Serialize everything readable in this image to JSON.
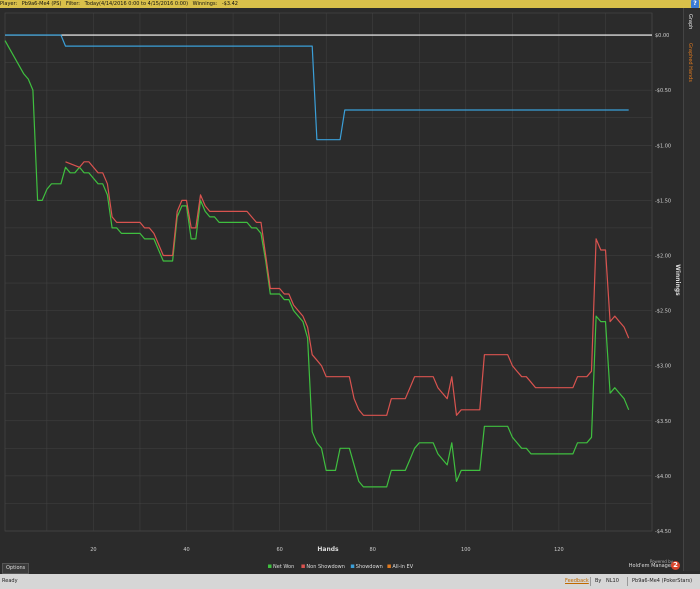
{
  "header": {
    "player_label": "Player:",
    "player_value": "Pb9a6-Me4 (PS)",
    "filter_label": "Filter:",
    "filter_value": "Today(4/14/2016 0:00 to 4/15/2016 0:00)",
    "winnings_label": "Winnings:",
    "winnings_value": "-$3.42",
    "help": "?"
  },
  "sidebar": {
    "tab_graph": "Graph",
    "tab_graphed_hands": "Graphed Hands"
  },
  "footer": {
    "options_label": "Options",
    "powered_by": "Powered by",
    "brand": "Hold'em Manager",
    "brand_badge": "2"
  },
  "statusbar": {
    "ready": "Ready",
    "feedback": "Feedback",
    "by": "By",
    "database": "NL10",
    "player": "Pb9a6-Me4 (PokerStars)"
  },
  "colors": {
    "background": "#2b2b2b",
    "grid": "#444444",
    "net_won": "#3fbf3f",
    "non_showdown": "#d9534f",
    "showdown": "#3b9fd8",
    "all_in_ev": "#e07a1f",
    "zero_line": "#ffffff"
  },
  "chart_data": {
    "type": "line",
    "xlabel": "Hands",
    "ylabel": "Winnings",
    "xlim": [
      1,
      140
    ],
    "ylim": [
      -4.5,
      0.2
    ],
    "x_ticks": [
      20,
      40,
      60,
      80,
      100,
      120
    ],
    "y_ticks": [
      "$0.00",
      "-$0.50",
      "-$1.00",
      "-$1.50",
      "-$2.00",
      "-$2.50",
      "-$3.00",
      "-$3.50",
      "-$4.00",
      "-$4.50"
    ],
    "y_tick_values": [
      0,
      -0.5,
      -1.0,
      -1.5,
      -2.0,
      -2.5,
      -3.0,
      -3.5,
      -4.0,
      -4.5
    ],
    "grid": true,
    "legend_position": "bottom-center",
    "series": [
      {
        "name": "Net Won",
        "color": "#3fbf3f",
        "points": [
          [
            1,
            -0.05
          ],
          [
            3,
            -0.2
          ],
          [
            5,
            -0.35
          ],
          [
            6,
            -0.4
          ],
          [
            7,
            -0.5
          ],
          [
            8,
            -1.5
          ],
          [
            9,
            -1.5
          ],
          [
            10,
            -1.4
          ],
          [
            11,
            -1.35
          ],
          [
            12,
            -1.35
          ],
          [
            13,
            -1.35
          ],
          [
            14,
            -1.2
          ],
          [
            15,
            -1.25
          ],
          [
            16,
            -1.25
          ],
          [
            17,
            -1.2
          ],
          [
            18,
            -1.25
          ],
          [
            19,
            -1.25
          ],
          [
            20,
            -1.3
          ],
          [
            21,
            -1.35
          ],
          [
            22,
            -1.35
          ],
          [
            23,
            -1.45
          ],
          [
            24,
            -1.75
          ],
          [
            25,
            -1.75
          ],
          [
            26,
            -1.8
          ],
          [
            27,
            -1.8
          ],
          [
            28,
            -1.8
          ],
          [
            29,
            -1.8
          ],
          [
            30,
            -1.8
          ],
          [
            31,
            -1.85
          ],
          [
            32,
            -1.85
          ],
          [
            33,
            -1.85
          ],
          [
            34,
            -1.95
          ],
          [
            35,
            -2.05
          ],
          [
            36,
            -2.05
          ],
          [
            37,
            -2.05
          ],
          [
            38,
            -1.65
          ],
          [
            39,
            -1.55
          ],
          [
            40,
            -1.55
          ],
          [
            41,
            -1.85
          ],
          [
            42,
            -1.85
          ],
          [
            43,
            -1.5
          ],
          [
            44,
            -1.6
          ],
          [
            45,
            -1.65
          ],
          [
            46,
            -1.65
          ],
          [
            47,
            -1.7
          ],
          [
            48,
            -1.7
          ],
          [
            49,
            -1.7
          ],
          [
            50,
            -1.7
          ],
          [
            51,
            -1.7
          ],
          [
            52,
            -1.7
          ],
          [
            53,
            -1.7
          ],
          [
            54,
            -1.75
          ],
          [
            55,
            -1.75
          ],
          [
            56,
            -1.8
          ],
          [
            57,
            -2.05
          ],
          [
            58,
            -2.35
          ],
          [
            59,
            -2.35
          ],
          [
            60,
            -2.35
          ],
          [
            61,
            -2.4
          ],
          [
            62,
            -2.4
          ],
          [
            63,
            -2.5
          ],
          [
            64,
            -2.55
          ],
          [
            65,
            -2.6
          ],
          [
            66,
            -2.75
          ],
          [
            67,
            -3.6
          ],
          [
            68,
            -3.7
          ],
          [
            69,
            -3.75
          ],
          [
            70,
            -3.95
          ],
          [
            71,
            -3.95
          ],
          [
            72,
            -3.95
          ],
          [
            73,
            -3.75
          ],
          [
            74,
            -3.75
          ],
          [
            75,
            -3.75
          ],
          [
            76,
            -3.9
          ],
          [
            77,
            -4.05
          ],
          [
            78,
            -4.1
          ],
          [
            79,
            -4.1
          ],
          [
            80,
            -4.1
          ],
          [
            81,
            -4.1
          ],
          [
            82,
            -4.1
          ],
          [
            83,
            -4.1
          ],
          [
            84,
            -3.95
          ],
          [
            85,
            -3.95
          ],
          [
            86,
            -3.95
          ],
          [
            87,
            -3.95
          ],
          [
            88,
            -3.85
          ],
          [
            89,
            -3.75
          ],
          [
            90,
            -3.7
          ],
          [
            91,
            -3.7
          ],
          [
            92,
            -3.7
          ],
          [
            93,
            -3.7
          ],
          [
            94,
            -3.8
          ],
          [
            95,
            -3.85
          ],
          [
            96,
            -3.9
          ],
          [
            97,
            -3.7
          ],
          [
            98,
            -4.05
          ],
          [
            99,
            -3.95
          ],
          [
            100,
            -3.95
          ],
          [
            101,
            -3.95
          ],
          [
            102,
            -3.95
          ],
          [
            103,
            -3.95
          ],
          [
            104,
            -3.55
          ],
          [
            105,
            -3.55
          ],
          [
            106,
            -3.55
          ],
          [
            107,
            -3.55
          ],
          [
            108,
            -3.55
          ],
          [
            109,
            -3.55
          ],
          [
            110,
            -3.65
          ],
          [
            111,
            -3.7
          ],
          [
            112,
            -3.75
          ],
          [
            113,
            -3.75
          ],
          [
            114,
            -3.8
          ],
          [
            115,
            -3.8
          ],
          [
            116,
            -3.8
          ],
          [
            117,
            -3.8
          ],
          [
            118,
            -3.8
          ],
          [
            119,
            -3.8
          ],
          [
            120,
            -3.8
          ],
          [
            121,
            -3.8
          ],
          [
            122,
            -3.8
          ],
          [
            123,
            -3.8
          ],
          [
            124,
            -3.7
          ],
          [
            125,
            -3.7
          ],
          [
            126,
            -3.7
          ],
          [
            127,
            -3.65
          ],
          [
            128,
            -2.55
          ],
          [
            129,
            -2.6
          ],
          [
            130,
            -2.6
          ],
          [
            131,
            -3.25
          ],
          [
            132,
            -3.2
          ],
          [
            133,
            -3.25
          ],
          [
            134,
            -3.3
          ],
          [
            135,
            -3.4
          ]
        ]
      },
      {
        "name": "Non Showdown",
        "color": "#d9534f",
        "points": [
          [
            14,
            -1.15
          ],
          [
            17,
            -1.2
          ],
          [
            18,
            -1.15
          ],
          [
            19,
            -1.15
          ],
          [
            20,
            -1.2
          ],
          [
            21,
            -1.25
          ],
          [
            22,
            -1.25
          ],
          [
            23,
            -1.35
          ],
          [
            24,
            -1.65
          ],
          [
            25,
            -1.7
          ],
          [
            26,
            -1.7
          ],
          [
            27,
            -1.7
          ],
          [
            28,
            -1.7
          ],
          [
            29,
            -1.7
          ],
          [
            30,
            -1.7
          ],
          [
            31,
            -1.75
          ],
          [
            32,
            -1.75
          ],
          [
            33,
            -1.8
          ],
          [
            34,
            -1.9
          ],
          [
            35,
            -2.0
          ],
          [
            36,
            -2.0
          ],
          [
            37,
            -2.0
          ],
          [
            38,
            -1.6
          ],
          [
            39,
            -1.5
          ],
          [
            40,
            -1.5
          ],
          [
            41,
            -1.75
          ],
          [
            42,
            -1.75
          ],
          [
            43,
            -1.45
          ],
          [
            44,
            -1.55
          ],
          [
            45,
            -1.6
          ],
          [
            46,
            -1.6
          ],
          [
            47,
            -1.6
          ],
          [
            48,
            -1.6
          ],
          [
            49,
            -1.6
          ],
          [
            50,
            -1.6
          ],
          [
            51,
            -1.6
          ],
          [
            52,
            -1.6
          ],
          [
            53,
            -1.6
          ],
          [
            54,
            -1.65
          ],
          [
            55,
            -1.7
          ],
          [
            56,
            -1.7
          ],
          [
            57,
            -2.0
          ],
          [
            58,
            -2.3
          ],
          [
            59,
            -2.3
          ],
          [
            60,
            -2.3
          ],
          [
            61,
            -2.35
          ],
          [
            62,
            -2.35
          ],
          [
            63,
            -2.45
          ],
          [
            64,
            -2.5
          ],
          [
            65,
            -2.55
          ],
          [
            66,
            -2.65
          ],
          [
            67,
            -2.9
          ],
          [
            68,
            -2.95
          ],
          [
            69,
            -3.0
          ],
          [
            70,
            -3.1
          ],
          [
            71,
            -3.1
          ],
          [
            72,
            -3.1
          ],
          [
            73,
            -3.1
          ],
          [
            74,
            -3.1
          ],
          [
            75,
            -3.1
          ],
          [
            76,
            -3.3
          ],
          [
            77,
            -3.4
          ],
          [
            78,
            -3.45
          ],
          [
            79,
            -3.45
          ],
          [
            80,
            -3.45
          ],
          [
            81,
            -3.45
          ],
          [
            82,
            -3.45
          ],
          [
            83,
            -3.45
          ],
          [
            84,
            -3.3
          ],
          [
            85,
            -3.3
          ],
          [
            86,
            -3.3
          ],
          [
            87,
            -3.3
          ],
          [
            88,
            -3.2
          ],
          [
            89,
            -3.1
          ],
          [
            90,
            -3.1
          ],
          [
            91,
            -3.1
          ],
          [
            92,
            -3.1
          ],
          [
            93,
            -3.1
          ],
          [
            94,
            -3.2
          ],
          [
            95,
            -3.25
          ],
          [
            96,
            -3.3
          ],
          [
            97,
            -3.1
          ],
          [
            98,
            -3.45
          ],
          [
            99,
            -3.4
          ],
          [
            100,
            -3.4
          ],
          [
            101,
            -3.4
          ],
          [
            102,
            -3.4
          ],
          [
            103,
            -3.4
          ],
          [
            104,
            -2.9
          ],
          [
            105,
            -2.9
          ],
          [
            106,
            -2.9
          ],
          [
            107,
            -2.9
          ],
          [
            108,
            -2.9
          ],
          [
            109,
            -2.9
          ],
          [
            110,
            -3.0
          ],
          [
            111,
            -3.05
          ],
          [
            112,
            -3.1
          ],
          [
            113,
            -3.1
          ],
          [
            114,
            -3.15
          ],
          [
            115,
            -3.2
          ],
          [
            116,
            -3.2
          ],
          [
            117,
            -3.2
          ],
          [
            118,
            -3.2
          ],
          [
            119,
            -3.2
          ],
          [
            120,
            -3.2
          ],
          [
            121,
            -3.2
          ],
          [
            122,
            -3.2
          ],
          [
            123,
            -3.2
          ],
          [
            124,
            -3.1
          ],
          [
            125,
            -3.1
          ],
          [
            126,
            -3.1
          ],
          [
            127,
            -3.05
          ],
          [
            128,
            -1.85
          ],
          [
            129,
            -1.95
          ],
          [
            130,
            -1.95
          ],
          [
            131,
            -2.6
          ],
          [
            132,
            -2.55
          ],
          [
            133,
            -2.6
          ],
          [
            134,
            -2.65
          ],
          [
            135,
            -2.75
          ]
        ]
      },
      {
        "name": "Showdown",
        "color": "#3b9fd8",
        "points": [
          [
            1,
            0.0
          ],
          [
            13,
            0.0
          ],
          [
            14,
            -0.1
          ],
          [
            67,
            -0.1
          ],
          [
            68,
            -0.95
          ],
          [
            73,
            -0.95
          ],
          [
            74,
            -0.68
          ],
          [
            135,
            -0.68
          ]
        ]
      },
      {
        "name": "All-in EV",
        "color": "#e07a1f",
        "points": []
      }
    ]
  }
}
